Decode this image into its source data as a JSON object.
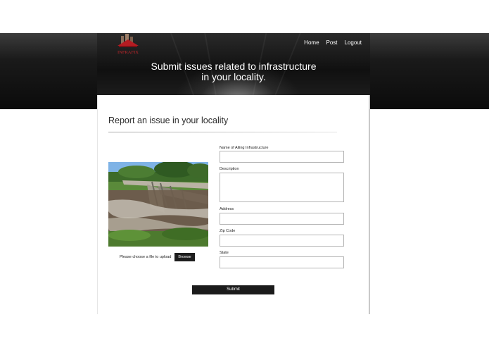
{
  "header": {
    "logo_text": "INFRAFIX",
    "nav": [
      "Home",
      "Post",
      "Logout"
    ],
    "tagline_line1": "Submit issues related to infrastructure",
    "tagline_line2": "in your locality."
  },
  "main": {
    "title": "Report an issue in your locality",
    "upload_label": "Please choose a file to upload",
    "browse_label": "Browse",
    "submit_label": "Submit",
    "fields": {
      "name_label": "Name of Ailing Infrastructure",
      "description_label": "Description",
      "address_label": "Address",
      "zip_label": "Zip Code",
      "state_label": "State"
    }
  },
  "colors": {
    "header_dark": "#0b0b0b",
    "button_dark": "#1e1e1e",
    "logo_red": "#b41c22"
  }
}
